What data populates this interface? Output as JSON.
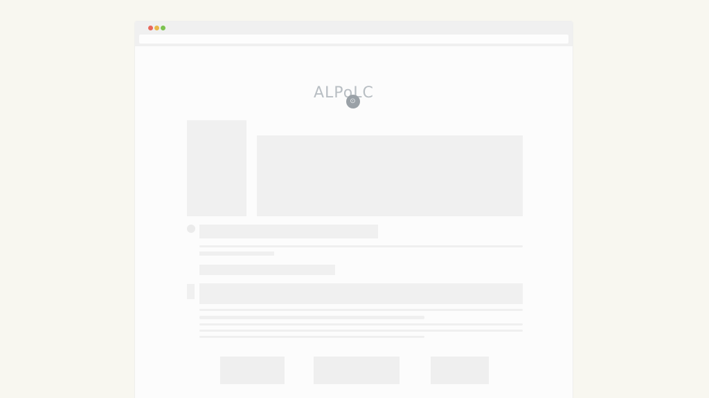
{
  "browser": {
    "window_controls": {
      "close_color": "#e8685c",
      "minimize_color": "#e8b74b",
      "zoom_color": "#7cc24f"
    },
    "address": ""
  },
  "logo": {
    "text": "ALPoLC",
    "badge_glyph": "⊙"
  }
}
